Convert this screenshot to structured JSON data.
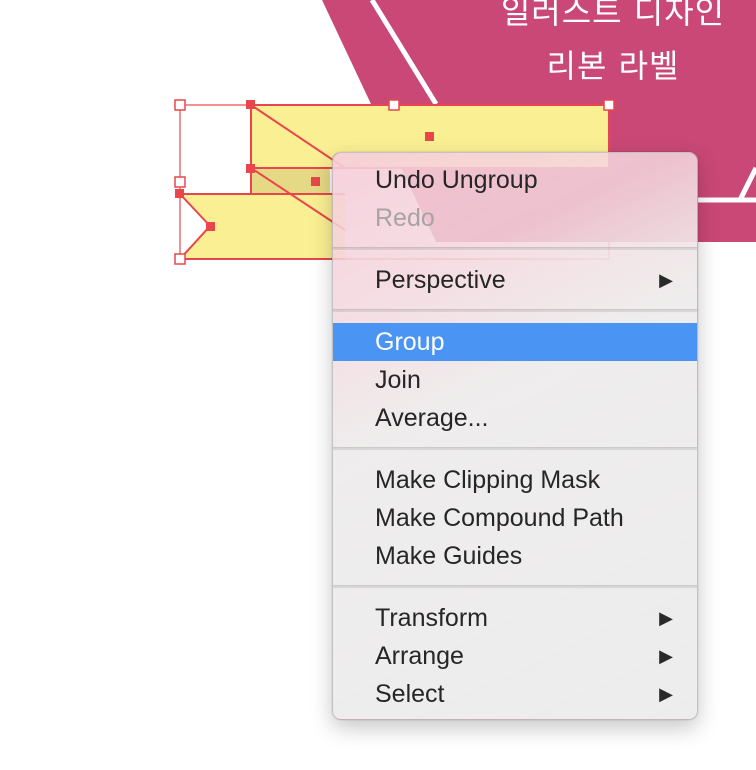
{
  "badge": {
    "line1": "일러스트 디자인",
    "line2": "리본 라벨",
    "color": "#c94875"
  },
  "artwork": {
    "fill_color": "#fbef94",
    "selection_color": "#e8464c"
  },
  "context_menu": {
    "highlight_color": "#4a95f4",
    "groups": [
      {
        "items": [
          {
            "label": "Undo Ungroup",
            "enabled": true
          },
          {
            "label": "Redo",
            "enabled": false
          }
        ]
      },
      {
        "items": [
          {
            "label": "Perspective",
            "submenu": true
          }
        ]
      },
      {
        "items": [
          {
            "label": "Group",
            "highlighted": true
          },
          {
            "label": "Join"
          },
          {
            "label": "Average..."
          }
        ]
      },
      {
        "items": [
          {
            "label": "Make Clipping Mask"
          },
          {
            "label": "Make Compound Path"
          },
          {
            "label": "Make Guides"
          }
        ]
      },
      {
        "items": [
          {
            "label": "Transform",
            "submenu": true
          },
          {
            "label": "Arrange",
            "submenu": true
          },
          {
            "label": "Select",
            "submenu": true
          }
        ]
      }
    ]
  }
}
